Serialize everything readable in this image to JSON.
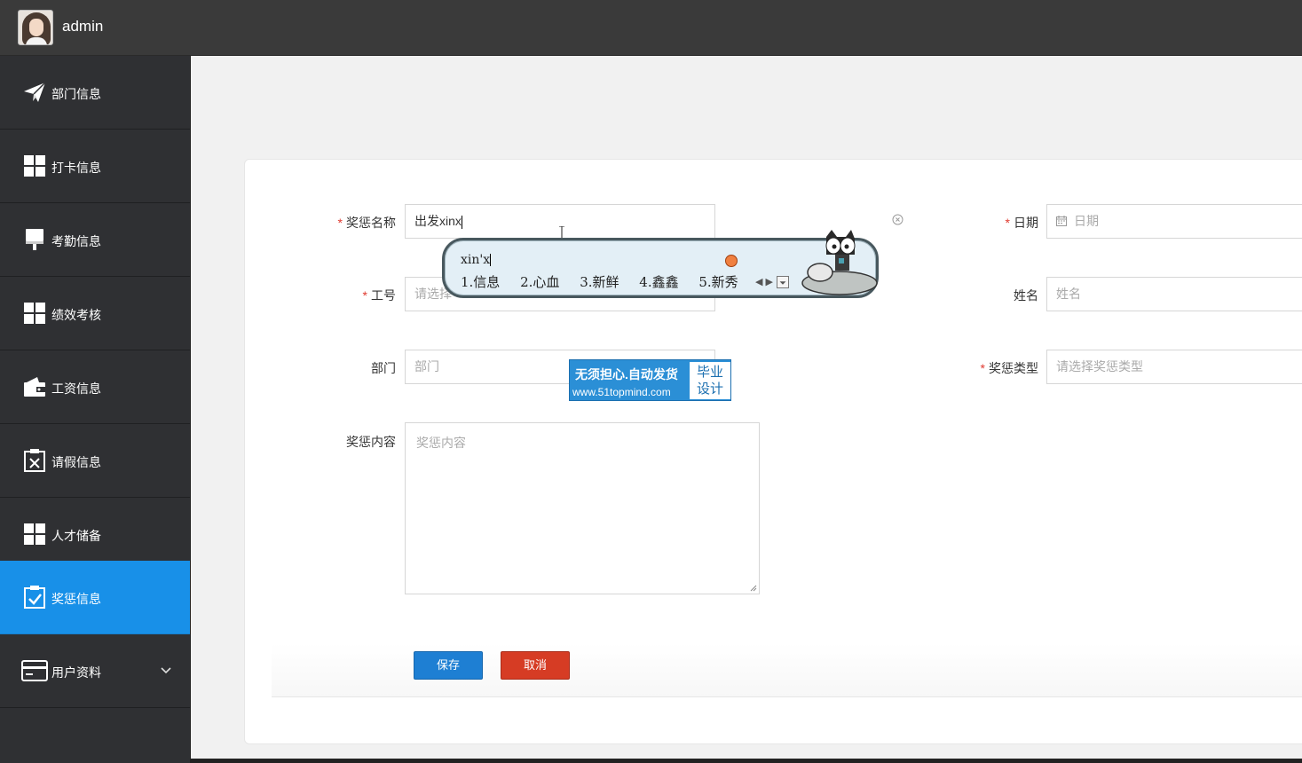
{
  "header": {
    "username": "admin"
  },
  "sidebar": {
    "items": [
      {
        "label": "部门信息",
        "icon": "paper-plane-icon"
      },
      {
        "label": "打卡信息",
        "icon": "grid-icon"
      },
      {
        "label": "考勤信息",
        "icon": "brush-icon"
      },
      {
        "label": "绩效考核",
        "icon": "grid-icon"
      },
      {
        "label": "工资信息",
        "icon": "wallet-icon"
      },
      {
        "label": "请假信息",
        "icon": "clipboard-x-icon"
      },
      {
        "label": "人才储备",
        "icon": "grid-icon"
      },
      {
        "label": "奖惩信息",
        "icon": "clipboard-check-icon",
        "active": true
      },
      {
        "label": "用户资料",
        "icon": "card-icon",
        "expandable": true
      }
    ]
  },
  "form": {
    "required_mark": "*",
    "reward_name": {
      "label": "奖惩名称",
      "value": "出发xinx"
    },
    "date": {
      "label": "日期",
      "placeholder": "日期"
    },
    "employee_no": {
      "label": "工号",
      "placeholder": "请选择"
    },
    "name": {
      "label": "姓名",
      "placeholder": "姓名"
    },
    "department": {
      "label": "部门",
      "placeholder": "部门"
    },
    "reward_type": {
      "label": "奖惩类型",
      "placeholder": "请选择奖惩类型"
    },
    "content": {
      "label": "奖惩内容",
      "placeholder": "奖惩内容"
    },
    "save_label": "保存",
    "cancel_label": "取消"
  },
  "ime": {
    "composition": "xin'x",
    "candidates": [
      "1.信息",
      "2.心血",
      "3.新鲜",
      "4.鑫鑫",
      "5.新秀"
    ]
  },
  "watermark": {
    "line1": "无须担心.自动发货",
    "line2": "www.51topmind.com",
    "badge_top": "毕业",
    "badge_bottom": "设计"
  },
  "colors": {
    "accent": "#1890e8",
    "danger": "#d63c24",
    "sidebar": "#2f3033",
    "topbar": "#3a3a3a"
  }
}
